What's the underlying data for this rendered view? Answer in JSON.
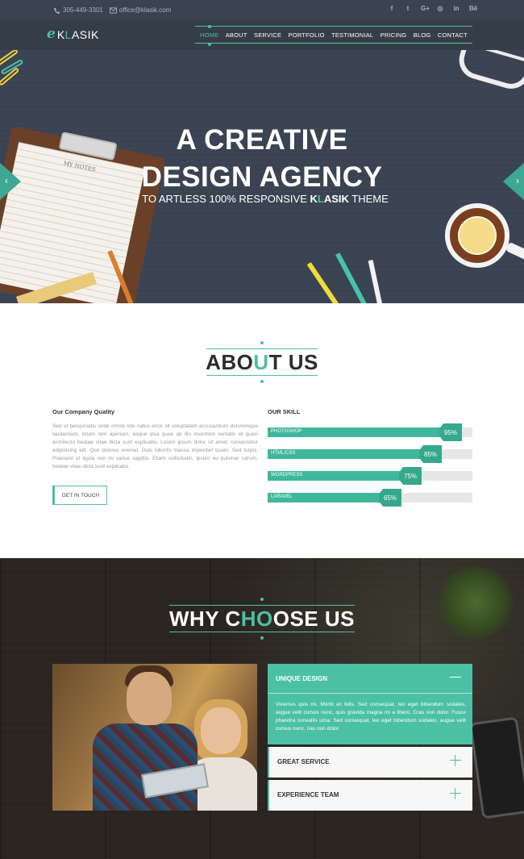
{
  "topbar": {
    "phone": "305-449-3301",
    "email": "office@klasik.com",
    "social": [
      "f",
      "t",
      "G+",
      "◎",
      "in",
      "Bē"
    ]
  },
  "nav": {
    "logo_mark": "e",
    "logo_pre": "K",
    "logo_hl": "L",
    "logo_post": "ASIK",
    "items": [
      "HOME",
      "ABOUT",
      "SERVICE",
      "PORTFOLIO",
      "TESTIMONIAL",
      "PRICING",
      "BLOG",
      "CONTACT"
    ],
    "active": "HOME"
  },
  "hero": {
    "line1": "A CREATIVE",
    "line2": "DESIGN AGENCY",
    "tagline_pre": "TO ARTLESS 100% RESPONSIVE ",
    "tagline_brand_a": "K",
    "tagline_brand_hl": "L",
    "tagline_brand_b": "ASIK",
    "tagline_post": " THEME",
    "prev": "‹",
    "next": "›",
    "notes_title": "MY NOTES"
  },
  "about": {
    "title_a": "ABO",
    "title_hl": "U",
    "title_b": "T US",
    "quality_heading": "Our Company Quality",
    "paragraph": "Sed ut perspiciatis unde omnis iste natus error sit voluptatem accusantium doloremque laudantium, totam rem aperiam, eaque ipsa quae ab illo inventore veritatis et quasi architecto beatae vitae dicta sunt explicabo. Lorem ipsum dolor sit amet, consectetur adipisicing elit. Quo dolores eveniet. Duis lobortis massa imperdiet quam. Sed turpis. Praesent ut ligula non mi varius sagittis. Etiam sollicitudin, ipsum eu pulvinar rutrum, beatae vitae dicta sunt explicabo.",
    "button": "GET IN TOUCH",
    "skill_heading": "OUR SKILL",
    "skills": [
      {
        "name": "PHOTOSHOP",
        "value": 95,
        "label": "95%"
      },
      {
        "name": "HTML/CSS",
        "value": 85,
        "label": "85%"
      },
      {
        "name": "WORDPRESS",
        "value": 75,
        "label": "75%"
      },
      {
        "name": "LARAVEL",
        "value": 65,
        "label": "65%"
      }
    ]
  },
  "why": {
    "title_a": "WHY C",
    "title_hl": "HO",
    "title_b": "OSE US",
    "accordion": [
      {
        "title": "UNIQUE DESIGN",
        "open": true,
        "body": "Vivamus quis mi. Morbi ac felis. Sed consequat, leo eget bibendum sodales, augue velit cursus nunc, quis gravida magna mi a libero. Cras non dolor. Fusce pharetra convallis urna. Sed consequat, leo eget bibendum sodales, augue velit cursus nunc, nas non dolor."
      },
      {
        "title": "GREAT SERVICE",
        "open": false,
        "body": ""
      },
      {
        "title": "EXPERIENCE TEAM",
        "open": false,
        "body": ""
      }
    ]
  },
  "colors": {
    "accent": "#4bc0a5",
    "dark": "#353d49",
    "hero_bg": "#3a4352"
  }
}
